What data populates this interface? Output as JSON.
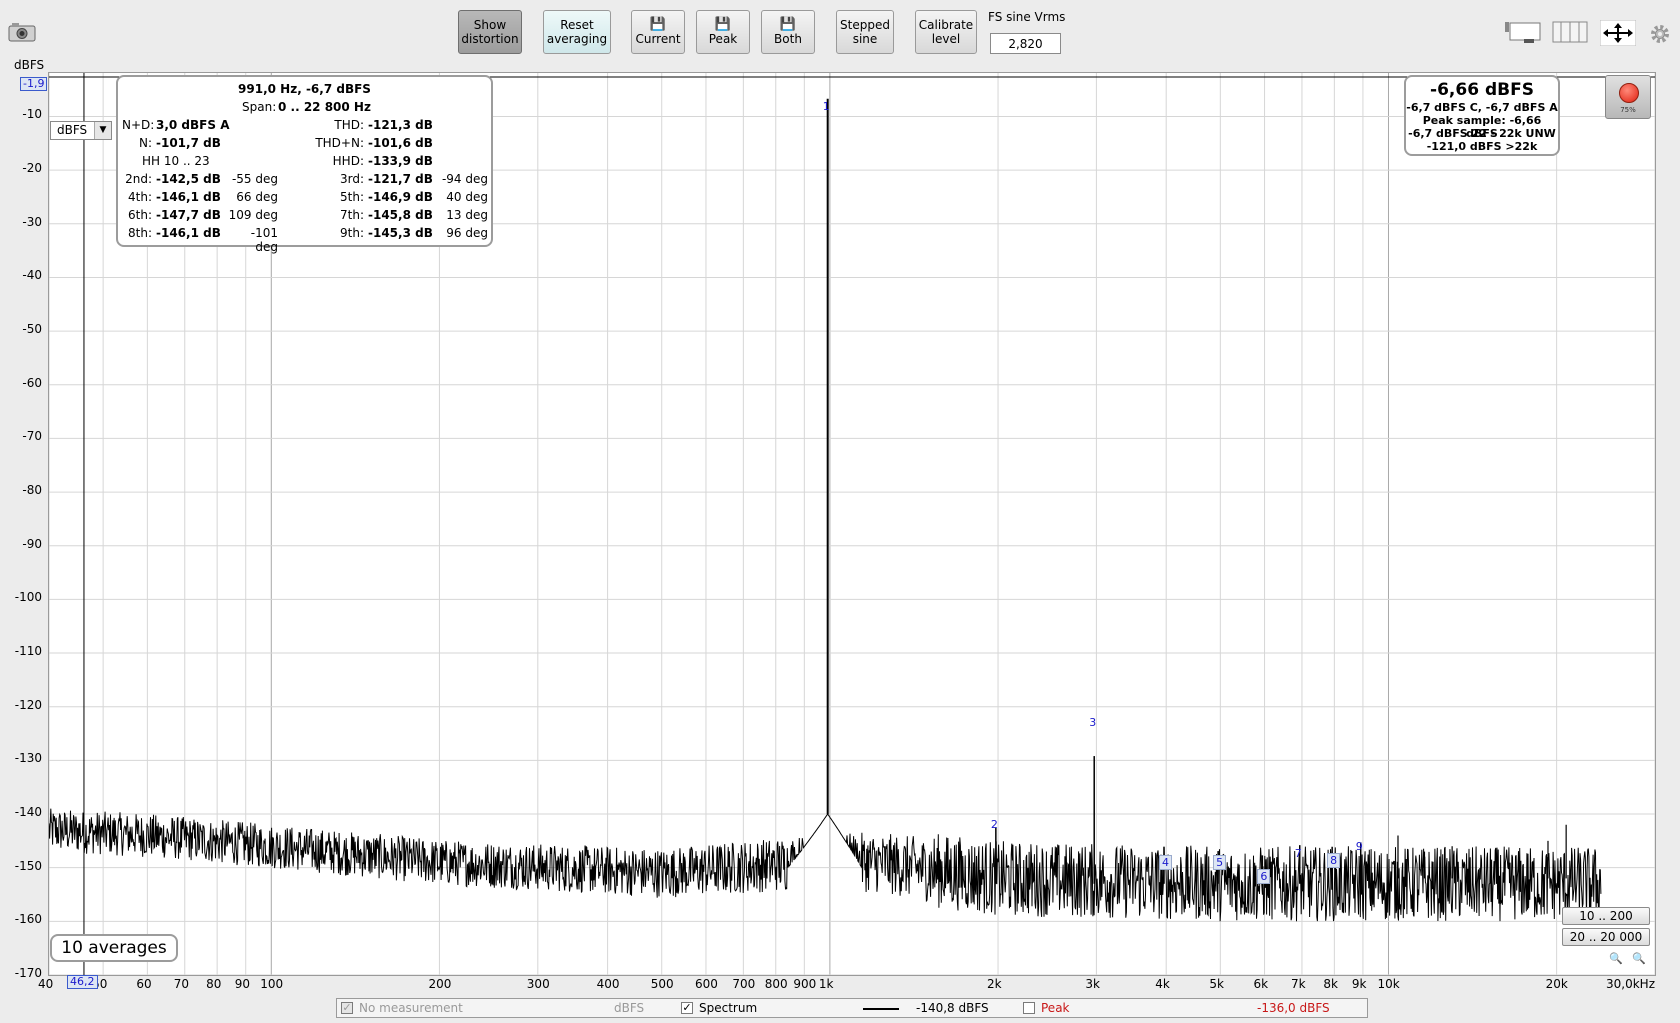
{
  "toolbar": {
    "show_distortion": "Show\ndistortion",
    "reset_averaging": "Reset\naveraging",
    "current": "Current",
    "peak": "Peak",
    "both": "Both",
    "stepped_sine": "Stepped\nsine",
    "calibrate_level": "Calibrate\nlevel",
    "fs_label": "FS sine Vrms",
    "fs_value": "2,820"
  },
  "y_unit": "dBFS",
  "y_marker": "-1,9",
  "unit_select": "dBFS",
  "x_marker": "46,2",
  "y_ticks": [
    "-10",
    "-20",
    "-30",
    "-40",
    "-50",
    "-60",
    "-70",
    "-80",
    "-90",
    "-100",
    "-110",
    "-120",
    "-130",
    "-140",
    "-150",
    "-160",
    "-170"
  ],
  "x_ticks": [
    "40",
    "50",
    "60",
    "70",
    "80",
    "90",
    "100",
    "200",
    "300",
    "400",
    "500",
    "600",
    "700",
    "800",
    "900",
    "1k",
    "2k",
    "3k",
    "4k",
    "5k",
    "6k",
    "7k",
    "8k",
    "9k",
    "10k",
    "20k",
    "30,0kHz"
  ],
  "distortion": {
    "header": "991,0 Hz, -6,7 dBFS",
    "span_label": "Span:",
    "span_value": "0 .. 22 800 Hz",
    "nd_label": "N+D:",
    "nd_value": "3,0 dBFS A",
    "thd_label": "THD:",
    "thd_value": "-121,3 dB",
    "n_label": "N:",
    "n_value": "-101,7 dB",
    "thdn_label": "THD+N:",
    "thdn_value": "-101,6 dB",
    "hh_label": "HH 10 .. 23",
    "hhd_label": "HHD:",
    "hhd_value": "-133,9 dB",
    "rows": [
      {
        "l1": "2nd:",
        "v1": "-142,5 dB",
        "p1": "-55 deg",
        "l2": "3rd:",
        "v2": "-121,7 dB",
        "p2": "-94 deg"
      },
      {
        "l1": "4th:",
        "v1": "-146,1 dB",
        "p1": "66 deg",
        "l2": "5th:",
        "v2": "-146,9 dB",
        "p2": "40 deg"
      },
      {
        "l1": "6th:",
        "v1": "-147,7 dB",
        "p1": "109 deg",
        "l2": "7th:",
        "v2": "-145,8 dB",
        "p2": "13 deg"
      },
      {
        "l1": "8th:",
        "v1": "-146,1 dB",
        "p1": "-101 deg",
        "l2": "9th:",
        "v2": "-145,3 dB",
        "p2": "96 deg"
      }
    ]
  },
  "level": {
    "main": "-6,66 dBFS",
    "line1": "-6,7 dBFS C, -6,7 dBFS A",
    "line2": "Peak sample: -6,66 dBFS",
    "line3": "-6,7 dBFS 22 - 22k UNW",
    "line4": "-121,0 dBFS >22k",
    "record_percent": "75%"
  },
  "averages": "10 averages",
  "range_buttons": {
    "low": "10 .. 200",
    "full": "20 .. 20 000"
  },
  "harmonic_labels": [
    "1",
    "2",
    "3",
    "4",
    "5",
    "6",
    "7",
    "8",
    "9"
  ],
  "legend": {
    "no_measurement": "No measurement",
    "no_measurement_unit": "dBFS",
    "spectrum": "Spectrum",
    "spectrum_value": "-140,8 dBFS",
    "peak": "Peak",
    "peak_value": "-136,0 dBFS"
  },
  "chart_data": {
    "type": "line",
    "xscale": "log",
    "xlim": [
      40,
      30000
    ],
    "ylim": [
      -170,
      -1.9
    ],
    "ylabel": "dBFS",
    "fundamental": {
      "x": 991,
      "y": -6.7
    },
    "harmonics": [
      {
        "n": 2,
        "x": 1982,
        "y": -142.5
      },
      {
        "n": 3,
        "x": 2973,
        "y": -121.7
      },
      {
        "n": 4,
        "x": 3964,
        "y": -146.1
      },
      {
        "n": 5,
        "x": 4955,
        "y": -146.9
      },
      {
        "n": 6,
        "x": 5946,
        "y": -147.7
      },
      {
        "n": 7,
        "x": 6937,
        "y": -145.8
      },
      {
        "n": 8,
        "x": 7928,
        "y": -146.1
      },
      {
        "n": 9,
        "x": 8919,
        "y": -145.3
      }
    ],
    "noise_floor": [
      {
        "x": 40,
        "y": -143
      },
      {
        "x": 60,
        "y": -144
      },
      {
        "x": 100,
        "y": -146
      },
      {
        "x": 200,
        "y": -149
      },
      {
        "x": 500,
        "y": -151
      },
      {
        "x": 900,
        "y": -149
      },
      {
        "x": 1200,
        "y": -149
      },
      {
        "x": 2000,
        "y": -152
      },
      {
        "x": 5000,
        "y": -153
      },
      {
        "x": 10000,
        "y": -153
      },
      {
        "x": 24000,
        "y": -153
      }
    ],
    "grid": true
  }
}
